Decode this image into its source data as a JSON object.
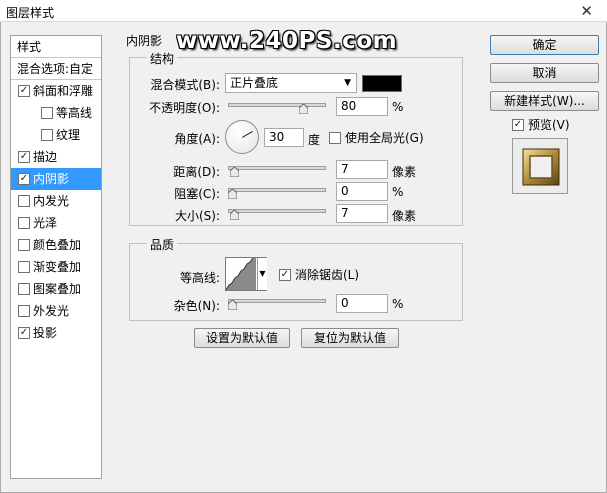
{
  "window": {
    "title": "图层样式",
    "close_glyph": "✕"
  },
  "style_list": {
    "header": "样式",
    "blending_options": "混合选项:自定",
    "items": [
      {
        "label": "斜面和浮雕",
        "checked": true,
        "indent": false,
        "selected": false
      },
      {
        "label": "等高线",
        "checked": false,
        "indent": true,
        "selected": false
      },
      {
        "label": "纹理",
        "checked": false,
        "indent": true,
        "selected": false
      },
      {
        "label": "描边",
        "checked": true,
        "indent": false,
        "selected": false
      },
      {
        "label": "内阴影",
        "checked": true,
        "indent": false,
        "selected": true
      },
      {
        "label": "内发光",
        "checked": false,
        "indent": false,
        "selected": false
      },
      {
        "label": "光泽",
        "checked": false,
        "indent": false,
        "selected": false
      },
      {
        "label": "颜色叠加",
        "checked": false,
        "indent": false,
        "selected": false
      },
      {
        "label": "渐变叠加",
        "checked": false,
        "indent": false,
        "selected": false
      },
      {
        "label": "图案叠加",
        "checked": false,
        "indent": false,
        "selected": false
      },
      {
        "label": "外发光",
        "checked": false,
        "indent": false,
        "selected": false
      },
      {
        "label": "投影",
        "checked": true,
        "indent": false,
        "selected": false
      }
    ]
  },
  "panel": {
    "title": "内阴影",
    "structure": {
      "title": "结构",
      "blend_mode_label": "混合模式(B):",
      "blend_mode_value": "正片叠底",
      "shadow_color": "#000000",
      "opacity_label": "不透明度(O):",
      "opacity_value": "80",
      "opacity_unit": "%",
      "opacity_level": 0.8,
      "angle_label": "角度(A):",
      "angle_value": "30",
      "angle_unit": "度",
      "global_light_label": "使用全局光(G)",
      "global_light_checked": false,
      "distance_label": "距离(D):",
      "distance_value": "7",
      "distance_unit": "像素",
      "choke_label": "阻塞(C):",
      "choke_value": "0",
      "choke_unit": "%",
      "size_label": "大小(S):",
      "size_value": "7",
      "size_unit": "像素"
    },
    "quality": {
      "title": "品质",
      "contour_label": "等高线:",
      "antialias_label": "消除锯齿(L)",
      "antialias_checked": true,
      "noise_label": "杂色(N):",
      "noise_value": "0",
      "noise_unit": "%"
    },
    "make_default": "设置为默认值",
    "reset_default": "复位为默认值"
  },
  "buttons": {
    "ok": "确定",
    "cancel": "取消",
    "new_style": "新建样式(W)...",
    "preview_label": "预览(V)",
    "preview_checked": true
  },
  "watermark": "www.240PS.com",
  "icons": {
    "checkmark": "✓",
    "dropdown": "▼"
  }
}
